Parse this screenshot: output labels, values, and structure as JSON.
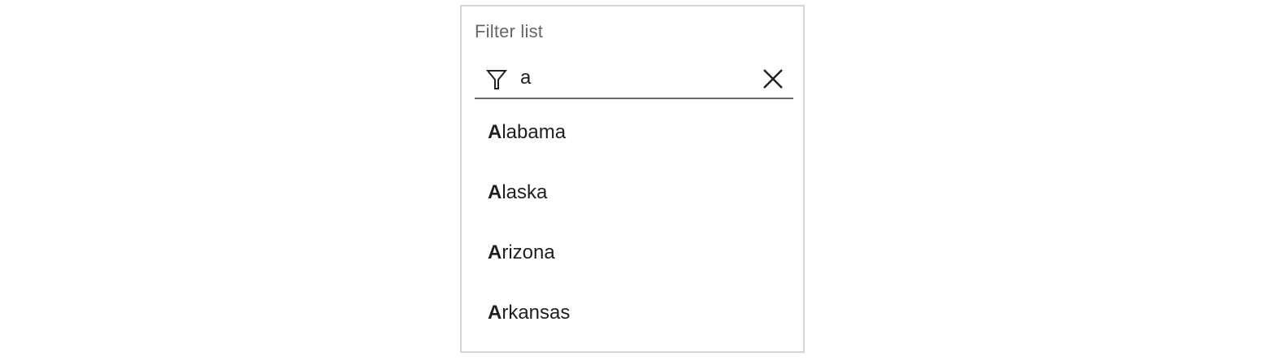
{
  "filter": {
    "label": "Filter list",
    "value": "a",
    "filter_icon": "filter-funnel-icon",
    "clear_icon": "close-x-icon"
  },
  "items": [
    {
      "match": "A",
      "rest": "labama"
    },
    {
      "match": "A",
      "rest": "laska"
    },
    {
      "match": "A",
      "rest": "rizona"
    },
    {
      "match": "A",
      "rest": "rkansas"
    }
  ],
  "colors": {
    "border": "#d6d6d6",
    "label": "#666666",
    "text": "#1f1f1f",
    "underline": "#6b6b6b"
  }
}
